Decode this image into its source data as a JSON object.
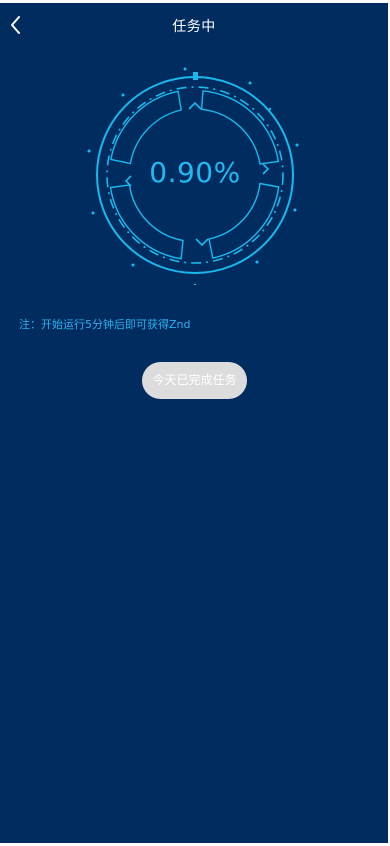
{
  "header": {
    "title": "任务中",
    "back_icon": "chevron-left-icon"
  },
  "gauge": {
    "progress_text": "0.90%",
    "progress_fraction": 0.009,
    "color": "#1ab9ec"
  },
  "note": {
    "text": "注：开始运行5分钟后即可获得Znd"
  },
  "action": {
    "button_label": "今天已完成任务"
  },
  "colors": {
    "background": "#002c60",
    "accent": "#1ab9ec",
    "note_text": "#2bb0f0",
    "button_bg": "#dcdcdc",
    "button_text": "#ffffff"
  }
}
